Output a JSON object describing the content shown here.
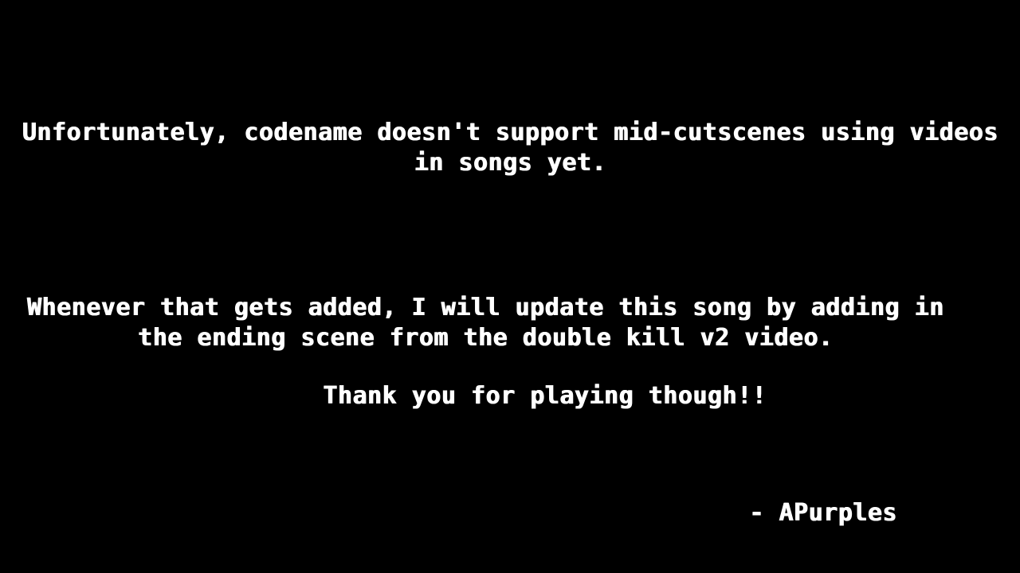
{
  "cutscene": {
    "message_1": "Unfortunately, codename doesn't support mid-cutscenes using videos in songs yet.",
    "message_2": "Whenever that gets added, I will update this song by adding in the ending scene from the double kill v2 video.",
    "message_3": "Thank you for playing though!!",
    "signature": "- APurples"
  },
  "colors": {
    "background": "#000000",
    "text": "#ffffff"
  }
}
